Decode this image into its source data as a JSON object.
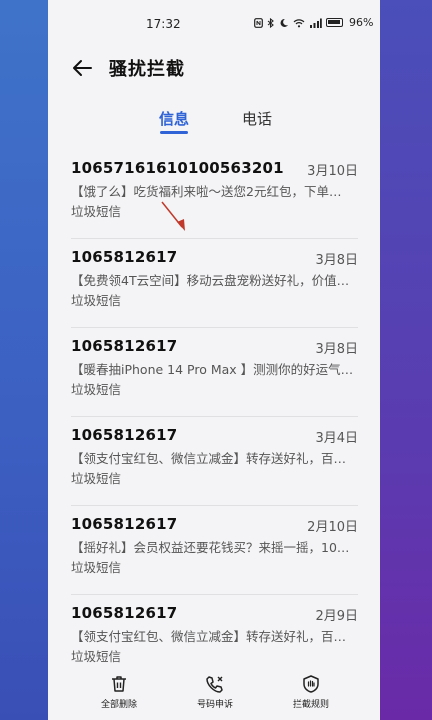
{
  "status_bar": {
    "time": "17:32",
    "battery_percent": "96%",
    "icons": [
      "nfc-icon",
      "bluetooth-icon",
      "moon-icon",
      "wifi-icon",
      "signal-icon",
      "battery-icon"
    ]
  },
  "header": {
    "title": "骚扰拦截",
    "back_icon": "arrow-left-icon"
  },
  "tabs": [
    {
      "label": "信息",
      "active": true
    },
    {
      "label": "电话",
      "active": false
    }
  ],
  "accent_color": "#2f63d6",
  "messages": [
    {
      "number": "10657161610100563201",
      "date": "3月10日",
      "preview": "【饿了么】吃货福利来啦～送您2元红包，下单…",
      "tag": "垃圾短信"
    },
    {
      "number": "1065812617",
      "date": "3月8日",
      "preview": "【免费领4T云空间】移动云盘宠粉送好礼，价值…",
      "tag": "垃圾短信"
    },
    {
      "number": "1065812617",
      "date": "3月8日",
      "preview": "【暖春抽iPhone 14 Pro Max 】测测你的好运气…",
      "tag": "垃圾短信"
    },
    {
      "number": "1065812617",
      "date": "3月4日",
      "preview": "【领支付宝红包、微信立减金】转存送好礼，百…",
      "tag": "垃圾短信"
    },
    {
      "number": "1065812617",
      "date": "2月10日",
      "preview": "【摇好礼】会员权益还要花钱买？来摇一摇，10…",
      "tag": "垃圾短信"
    },
    {
      "number": "1065812617",
      "date": "2月9日",
      "preview": "【领支付宝红包、微信立减金】转存送好礼，百…",
      "tag": "垃圾短信"
    }
  ],
  "bottom_bar": {
    "delete_all": "全部删除",
    "report_number": "号码申诉",
    "block_rules": "拦截规则"
  }
}
